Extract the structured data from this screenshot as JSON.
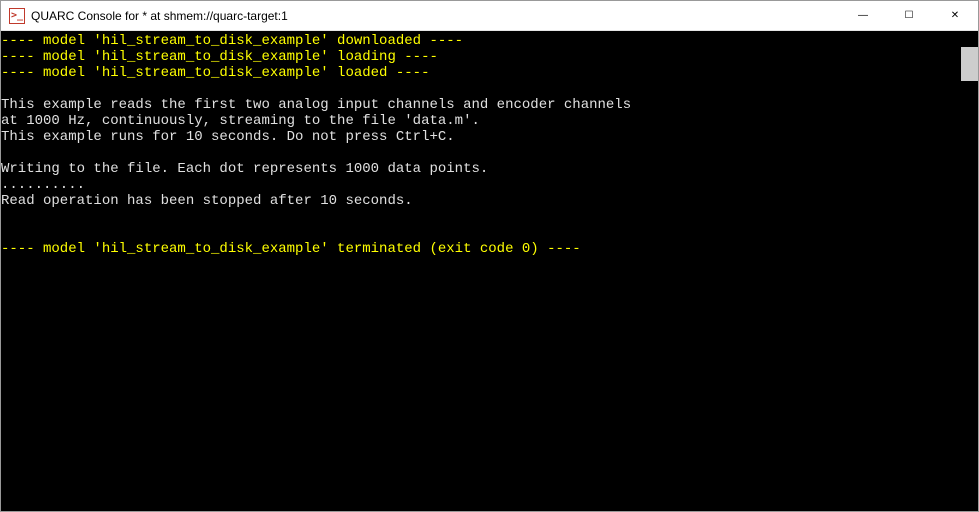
{
  "window": {
    "title": "QUARC Console for * at shmem://quarc-target:1",
    "icon_label": ">_"
  },
  "controls": {
    "minimize": "—",
    "maximize": "☐",
    "close": "✕"
  },
  "console": {
    "lines": [
      {
        "cls": "yellow",
        "text": "---- model 'hil_stream_to_disk_example' downloaded ----"
      },
      {
        "cls": "yellow",
        "text": "---- model 'hil_stream_to_disk_example' loading ----"
      },
      {
        "cls": "yellow",
        "text": "---- model 'hil_stream_to_disk_example' loaded ----"
      },
      {
        "cls": "white",
        "text": " "
      },
      {
        "cls": "white",
        "text": "This example reads the first two analog input channels and encoder channels"
      },
      {
        "cls": "white",
        "text": "at 1000 Hz, continuously, streaming to the file 'data.m'."
      },
      {
        "cls": "white",
        "text": "This example runs for 10 seconds. Do not press Ctrl+C."
      },
      {
        "cls": "white",
        "text": " "
      },
      {
        "cls": "white",
        "text": "Writing to the file. Each dot represents 1000 data points."
      },
      {
        "cls": "white",
        "text": ".........."
      },
      {
        "cls": "white",
        "text": "Read operation has been stopped after 10 seconds."
      },
      {
        "cls": "white",
        "text": " "
      },
      {
        "cls": "white",
        "text": " "
      },
      {
        "cls": "yellow",
        "text": "---- model 'hil_stream_to_disk_example' terminated (exit code 0) ----"
      }
    ]
  }
}
